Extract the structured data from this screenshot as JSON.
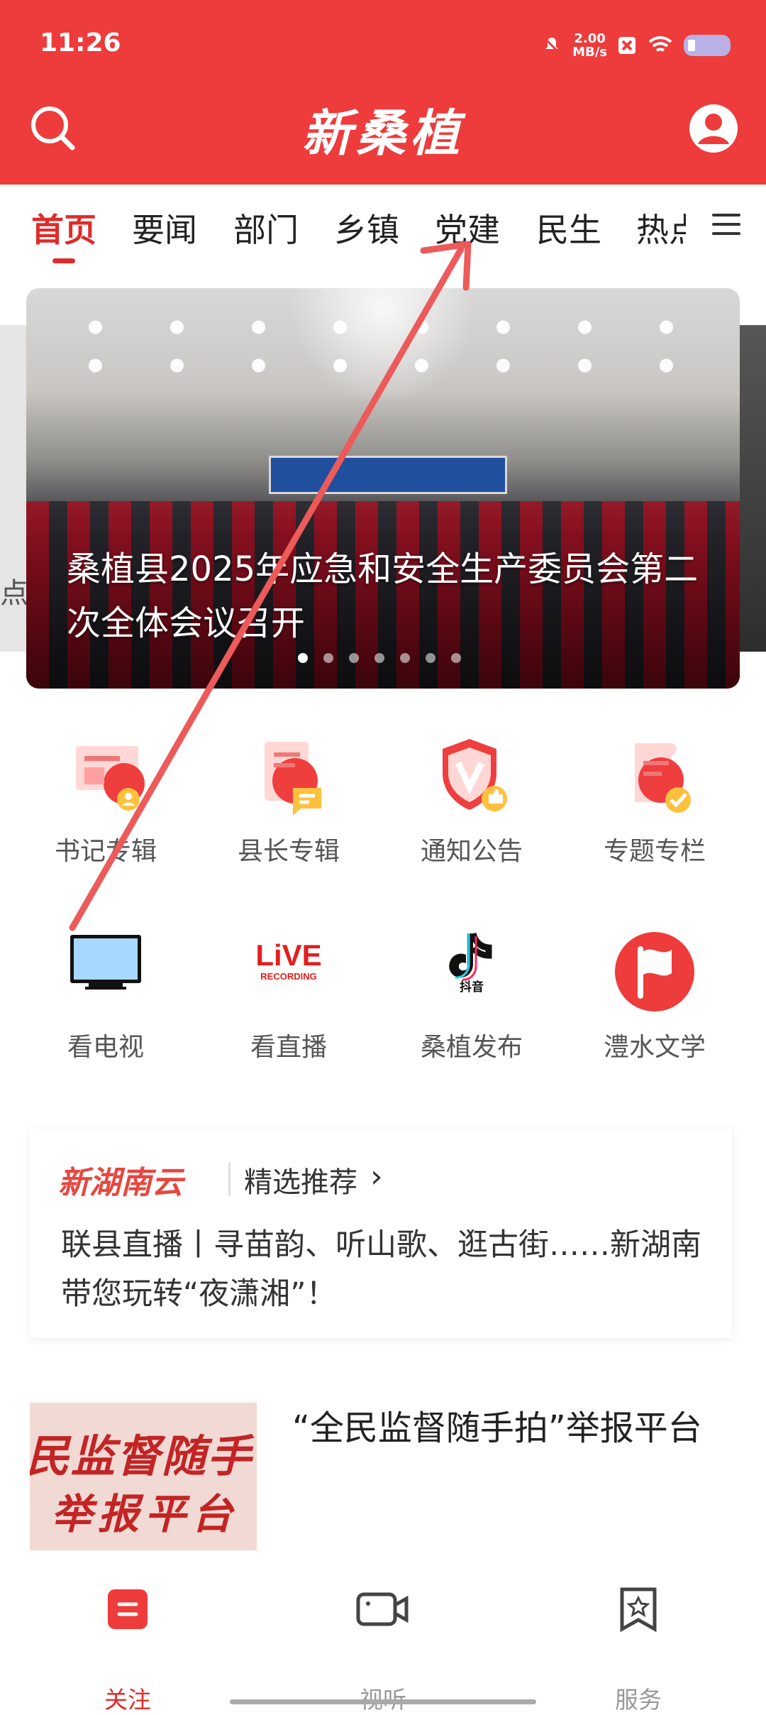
{
  "status_bar": {
    "time": "11:26",
    "speed_value": "2.00",
    "speed_unit": "MB/s"
  },
  "header": {
    "logo_text": "新桑植",
    "search_icon": "search-icon",
    "user_icon": "user-icon"
  },
  "tabs": [
    {
      "label": "首页"
    },
    {
      "label": "要闻"
    },
    {
      "label": "部门"
    },
    {
      "label": "乡镇"
    },
    {
      "label": "党建"
    },
    {
      "label": "民生"
    },
    {
      "label": "热点"
    }
  ],
  "banner": {
    "left_peek_text": "点",
    "title": "桑植县2025年应急和安全生产委员会第二次全体会议召开",
    "dots_count": 7,
    "active_dot": 1
  },
  "grid": [
    {
      "label": "书记专辑",
      "icon": "book-document-icon"
    },
    {
      "label": "县长专辑",
      "icon": "chat-document-icon"
    },
    {
      "label": "通知公告",
      "icon": "shield-icon"
    },
    {
      "label": "专题专栏",
      "icon": "scroll-icon"
    },
    {
      "label": "看电视",
      "icon": "tv-icon"
    },
    {
      "label": "看直播",
      "icon": "live-recording-icon"
    },
    {
      "label": "桑植发布",
      "icon": "douyin-icon"
    },
    {
      "label": "澧水文学",
      "icon": "flag-icon"
    }
  ],
  "live_badge": {
    "main": "LiVE",
    "sub": "RECORDING"
  },
  "douyin_label": "抖音",
  "recommendation": {
    "brand": "新湖南云",
    "label": "精选推荐",
    "text": "联县直播丨寻苗韵、听山歌、逛古街……新湖南带您玩转“夜潇湘”！"
  },
  "news": {
    "thumb_line_1": "民监督随手",
    "thumb_line_2": "举报平台",
    "title": "“全民监督随手拍”举报平台"
  },
  "bottom_nav": [
    {
      "label": "关注",
      "icon": "follow-icon",
      "active": true
    },
    {
      "label": "视听",
      "icon": "video-icon",
      "active": false
    },
    {
      "label": "服务",
      "icon": "service-bookmark-icon",
      "active": false
    }
  ],
  "colors": {
    "brand_red": "#ee3b3b",
    "active_red": "#e02b2b",
    "annotation_red": "#ec5a5a"
  }
}
